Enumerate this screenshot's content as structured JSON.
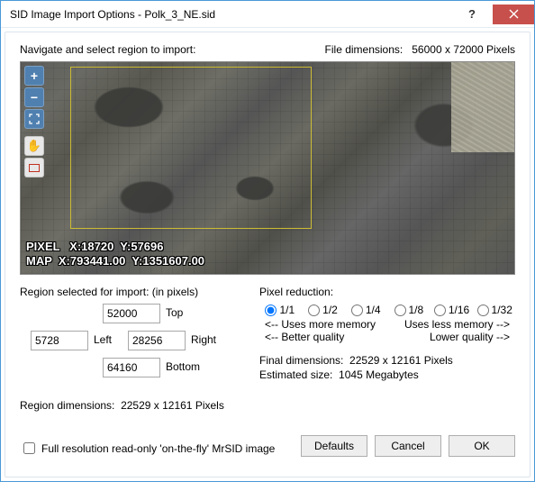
{
  "titlebar": {
    "title": "SID Image Import Options - Polk_3_NE.sid"
  },
  "top": {
    "nav_label": "Navigate and select region to import:",
    "file_dims_label": "File dimensions:",
    "file_dims_value": "56000 x 72000 Pixels"
  },
  "readout": {
    "pixel_line": "PIXEL   X:18720  Y:57696",
    "map_line": "MAP  X:793441.00  Y:1351607.00"
  },
  "region": {
    "heading": "Region selected for import:  (in pixels)",
    "top_label": "Top",
    "top_value": "52000",
    "left_label": "Left",
    "left_value": "5728",
    "right_label": "Right",
    "right_value": "28256",
    "bottom_label": "Bottom",
    "bottom_value": "64160",
    "dims_label": "Region dimensions:",
    "dims_value": "22529 x 12161 Pixels"
  },
  "reduction": {
    "heading": "Pixel reduction:",
    "options": [
      "1/1",
      "1/2",
      "1/4",
      "1/8",
      "1/16",
      "1/32"
    ],
    "selected": "1/1",
    "mem_left": "<-- Uses more memory",
    "mem_right": "Uses less memory -->",
    "qual_left": "<-- Better quality",
    "qual_right": "Lower quality -->",
    "final_dims_label": "Final dimensions:",
    "final_dims_value": "22529 x 12161 Pixels",
    "est_label": "Estimated size:",
    "est_value": "1045 Megabytes"
  },
  "footer": {
    "checkbox_label": "Full resolution read-only 'on-the-fly' MrSID image",
    "defaults": "Defaults",
    "cancel": "Cancel",
    "ok": "OK"
  }
}
